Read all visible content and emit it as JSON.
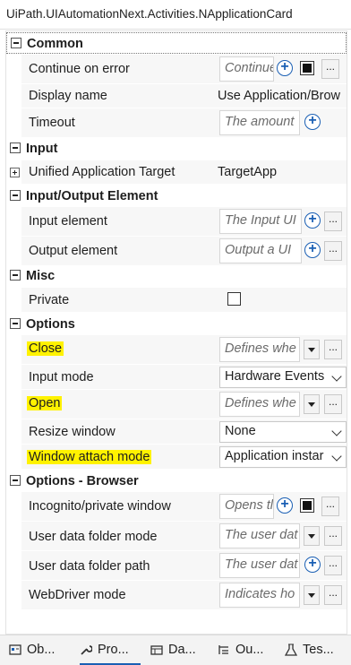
{
  "header": {
    "title": "UiPath.UIAutomationNext.Activities.NApplicationCard"
  },
  "categories": {
    "common": "Common",
    "input": "Input",
    "input_output": "Input/Output Element",
    "misc": "Misc",
    "options": "Options",
    "options_browser": "Options - Browser"
  },
  "props": {
    "continue_on_error": {
      "name": "Continue on error",
      "placeholder": "Continue"
    },
    "display_name": {
      "name": "Display name",
      "value": "Use Application/Brow"
    },
    "timeout": {
      "name": "Timeout",
      "placeholder": "The amount"
    },
    "unified_target": {
      "name": "Unified Application Target",
      "value": "TargetApp"
    },
    "input_element": {
      "name": "Input element",
      "placeholder": "The Input UI"
    },
    "output_element": {
      "name": "Output element",
      "placeholder": "Output a UI"
    },
    "private": {
      "name": "Private"
    },
    "close": {
      "name": "Close",
      "placeholder": "Defines whe"
    },
    "input_mode": {
      "name": "Input mode",
      "value": "Hardware Events"
    },
    "open": {
      "name": "Open",
      "placeholder": "Defines whe"
    },
    "resize_window": {
      "name": "Resize window",
      "value": "None"
    },
    "window_attach_mode": {
      "name": "Window attach mode",
      "value": "Application instar"
    },
    "incognito": {
      "name": "Incognito/private window",
      "placeholder": "Opens tl"
    },
    "user_data_folder_mode": {
      "name": "User data folder mode",
      "placeholder": "The user dat"
    },
    "user_data_folder_path": {
      "name": "User data folder path",
      "placeholder": "The user dat"
    },
    "webdriver_mode": {
      "name": "WebDriver mode",
      "placeholder": "Indicates ho"
    }
  },
  "buttons": {
    "ellipsis": "...",
    "plus": "+"
  },
  "tabs": [
    {
      "label": "Ob...",
      "icon": "object-repository-icon"
    },
    {
      "label": "Pro...",
      "icon": "wrench-icon"
    },
    {
      "label": "Da...",
      "icon": "data-manager-icon"
    },
    {
      "label": "Ou...",
      "icon": "outline-icon"
    },
    {
      "label": "Tes...",
      "icon": "test-explorer-icon"
    }
  ],
  "colors": {
    "highlight": "#fff200",
    "accent": "#1a5fb4"
  }
}
